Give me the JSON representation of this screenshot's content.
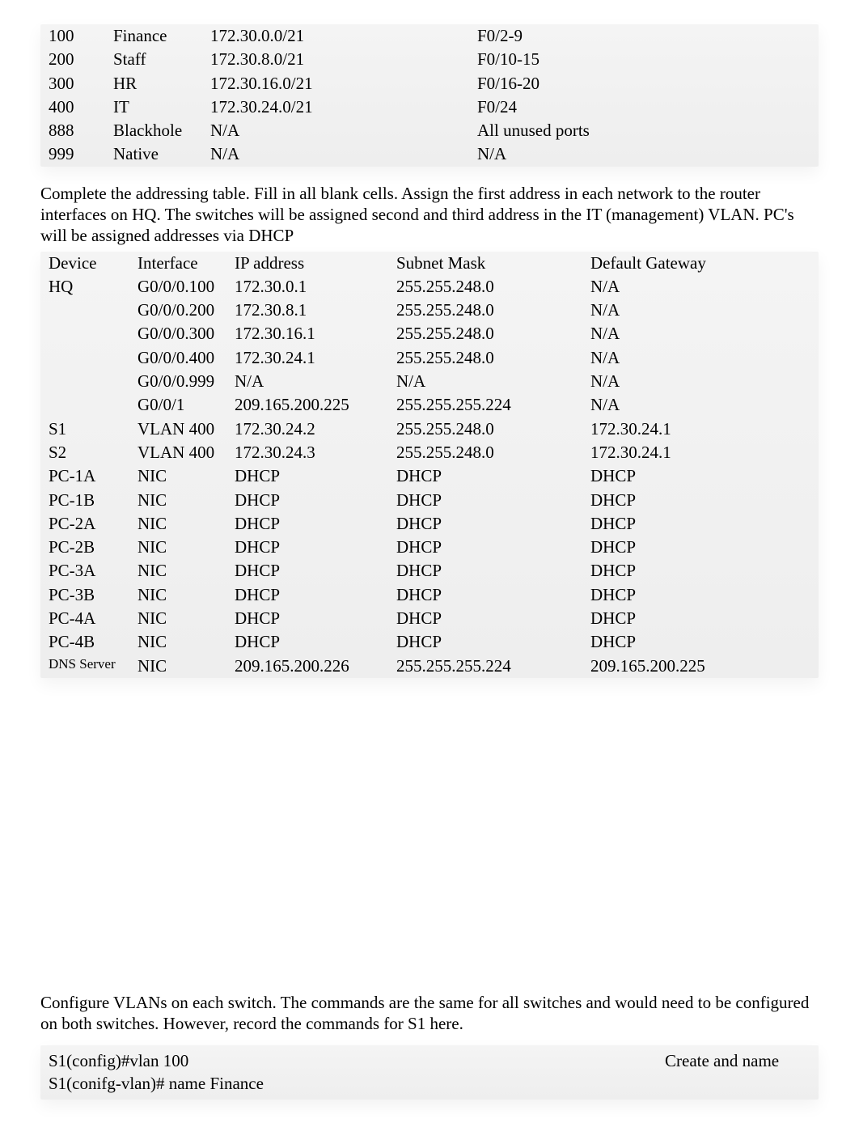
{
  "vlan_table": {
    "rows": [
      {
        "id": "100",
        "name": "Finance",
        "network": "172.30.0.0/21",
        "ports": "F0/2-9"
      },
      {
        "id": "200",
        "name": "Staff",
        "network": "172.30.8.0/21",
        "ports": "F0/10-15"
      },
      {
        "id": "300",
        "name": "HR",
        "network": "172.30.16.0/21",
        "ports": "F0/16-20"
      },
      {
        "id": "400",
        "name": "IT",
        "network": "172.30.24.0/21",
        "ports": "F0/24"
      },
      {
        "id": "888",
        "name": "Blackhole",
        "network": "N/A",
        "ports": "All unused ports"
      },
      {
        "id": "999",
        "name": "Native",
        "network": "N/A",
        "ports": "N/A"
      }
    ]
  },
  "instructions_1": "Complete the addressing table. Fill in all blank cells. Assign the first address in each network to the router interfaces on HQ. The switches will be assigned second and third address in the IT (management) VLAN. PC's will be assigned addresses via DHCP",
  "addr_table": {
    "headers": {
      "device": "Device",
      "interface": "Interface",
      "ip": "IP address",
      "mask": "Subnet Mask",
      "gw": "Default Gateway"
    },
    "rows": [
      {
        "device": "HQ",
        "interface": "G0/0/0.100",
        "ip": "172.30.0.1",
        "mask": "255.255.248.0",
        "gw": "N/A"
      },
      {
        "device": "",
        "interface": "G0/0/0.200",
        "ip": "172.30.8.1",
        "mask": "255.255.248.0",
        "gw": "N/A"
      },
      {
        "device": "",
        "interface": "G0/0/0.300",
        "ip": "172.30.16.1",
        "mask": "255.255.248.0",
        "gw": "N/A"
      },
      {
        "device": "",
        "interface": "G0/0/0.400",
        "ip": "172.30.24.1",
        "mask": "255.255.248.0",
        "gw": "N/A"
      },
      {
        "device": "",
        "interface": "G0/0/0.999",
        "ip": "N/A",
        "mask": "N/A",
        "gw": "N/A"
      },
      {
        "device": "",
        "interface": "G0/0/1",
        "ip": "209.165.200.225",
        "mask": "255.255.255.224",
        "gw": "N/A"
      },
      {
        "device": "S1",
        "interface": "VLAN 400",
        "ip": "172.30.24.2",
        "mask": "255.255.248.0",
        "gw": "172.30.24.1"
      },
      {
        "device": "S2",
        "interface": "VLAN 400",
        "ip": "172.30.24.3",
        "mask": "255.255.248.0",
        "gw": "172.30.24.1"
      },
      {
        "device": "PC-1A",
        "interface": "NIC",
        "ip": "DHCP",
        "mask": "DHCP",
        "gw": "DHCP"
      },
      {
        "device": "PC-1B",
        "interface": "NIC",
        "ip": "DHCP",
        "mask": "DHCP",
        "gw": "DHCP"
      },
      {
        "device": "PC-2A",
        "interface": "NIC",
        "ip": "DHCP",
        "mask": "DHCP",
        "gw": "DHCP"
      },
      {
        "device": "PC-2B",
        "interface": "NIC",
        "ip": "DHCP",
        "mask": "DHCP",
        "gw": "DHCP"
      },
      {
        "device": "PC-3A",
        "interface": "NIC",
        "ip": "DHCP",
        "mask": "DHCP",
        "gw": "DHCP"
      },
      {
        "device": "PC-3B",
        "interface": "NIC",
        "ip": "DHCP",
        "mask": "DHCP",
        "gw": "DHCP"
      },
      {
        "device": "PC-4A",
        "interface": "NIC",
        "ip": "DHCP",
        "mask": "DHCP",
        "gw": "DHCP"
      },
      {
        "device": "PC-4B",
        "interface": "NIC",
        "ip": "DHCP",
        "mask": "DHCP",
        "gw": "DHCP"
      },
      {
        "device": "DNS Server",
        "interface": "NIC",
        "ip": "209.165.200.226",
        "mask": "255.255.255.224",
        "gw": "209.165.200.225",
        "small": true
      }
    ]
  },
  "instructions_2": "Configure VLANs on each switch.  The commands are the same for all switches and would need to be configured on both switches.  However, record the commands for S1 here.",
  "cmd_block": {
    "line1": "S1(config)#vlan 100",
    "line2": "S1(conifg-vlan)# name Finance",
    "note": "Create and name"
  }
}
